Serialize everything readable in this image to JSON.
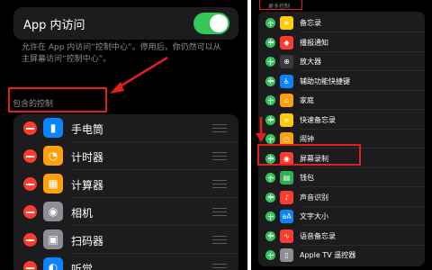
{
  "left": {
    "toggle": {
      "label": "App 内访问",
      "state": "on"
    },
    "description": "允许在 App 内访问“控制中心”。停用后，你仍然可以从主屏幕访问“控制中心”。",
    "section_title": "包含的控制",
    "items": [
      {
        "label": "手电筒",
        "icon": "flashlight-icon",
        "color": "#0a84ff",
        "glyph": "▮"
      },
      {
        "label": "计时器",
        "icon": "timer-icon",
        "color": "#ff9f0a",
        "glyph": "◔"
      },
      {
        "label": "计算器",
        "icon": "calculator-icon",
        "color": "#ff9f0a",
        "glyph": "▦"
      },
      {
        "label": "相机",
        "icon": "camera-icon",
        "color": "#8e8e93",
        "glyph": "◉"
      },
      {
        "label": "扫码器",
        "icon": "qr-scanner-icon",
        "color": "#8e8e93",
        "glyph": "▣"
      },
      {
        "label": "听觉",
        "icon": "hearing-icon",
        "color": "#0a84ff",
        "glyph": "◐"
      }
    ]
  },
  "right": {
    "section_title": "更多控制",
    "items": [
      {
        "label": "备忘录",
        "icon": "notes-icon",
        "color": "#ffcc00",
        "glyph": "≡"
      },
      {
        "label": "播报通知",
        "icon": "announce-notifications-icon",
        "color": "#ff3b30",
        "glyph": "◆"
      },
      {
        "label": "放大器",
        "icon": "magnifier-icon",
        "color": "#3a3a3c",
        "glyph": "⊕"
      },
      {
        "label": "辅助功能快捷键",
        "icon": "accessibility-icon",
        "color": "#0a84ff",
        "glyph": "♿"
      },
      {
        "label": "家庭",
        "icon": "home-icon",
        "color": "#ff9f0a",
        "glyph": "⌂"
      },
      {
        "label": "快速备忘录",
        "icon": "quick-note-icon",
        "color": "#ffcc00",
        "glyph": "≡"
      },
      {
        "label": "闹钟",
        "icon": "alarm-icon",
        "color": "#ff9f0a",
        "glyph": "◷"
      },
      {
        "label": "屏幕录制",
        "icon": "screen-recording-icon",
        "color": "#ff3b30",
        "glyph": "◉"
      },
      {
        "label": "钱包",
        "icon": "wallet-icon",
        "color": "#30b050",
        "glyph": "▤"
      },
      {
        "label": "声音识别",
        "icon": "sound-recognition-icon",
        "color": "#ff3b30",
        "glyph": "♪"
      },
      {
        "label": "文字大小",
        "icon": "text-size-icon",
        "color": "#0a84ff",
        "glyph": "aA"
      },
      {
        "label": "语音备忘录",
        "icon": "voice-memos-icon",
        "color": "#ff3b30",
        "glyph": "∿"
      },
      {
        "label": "Apple TV 遥控器",
        "icon": "apple-tv-remote-icon",
        "color": "#8e8e93",
        "glyph": "▯"
      }
    ]
  },
  "annotation_color": "#e02020"
}
